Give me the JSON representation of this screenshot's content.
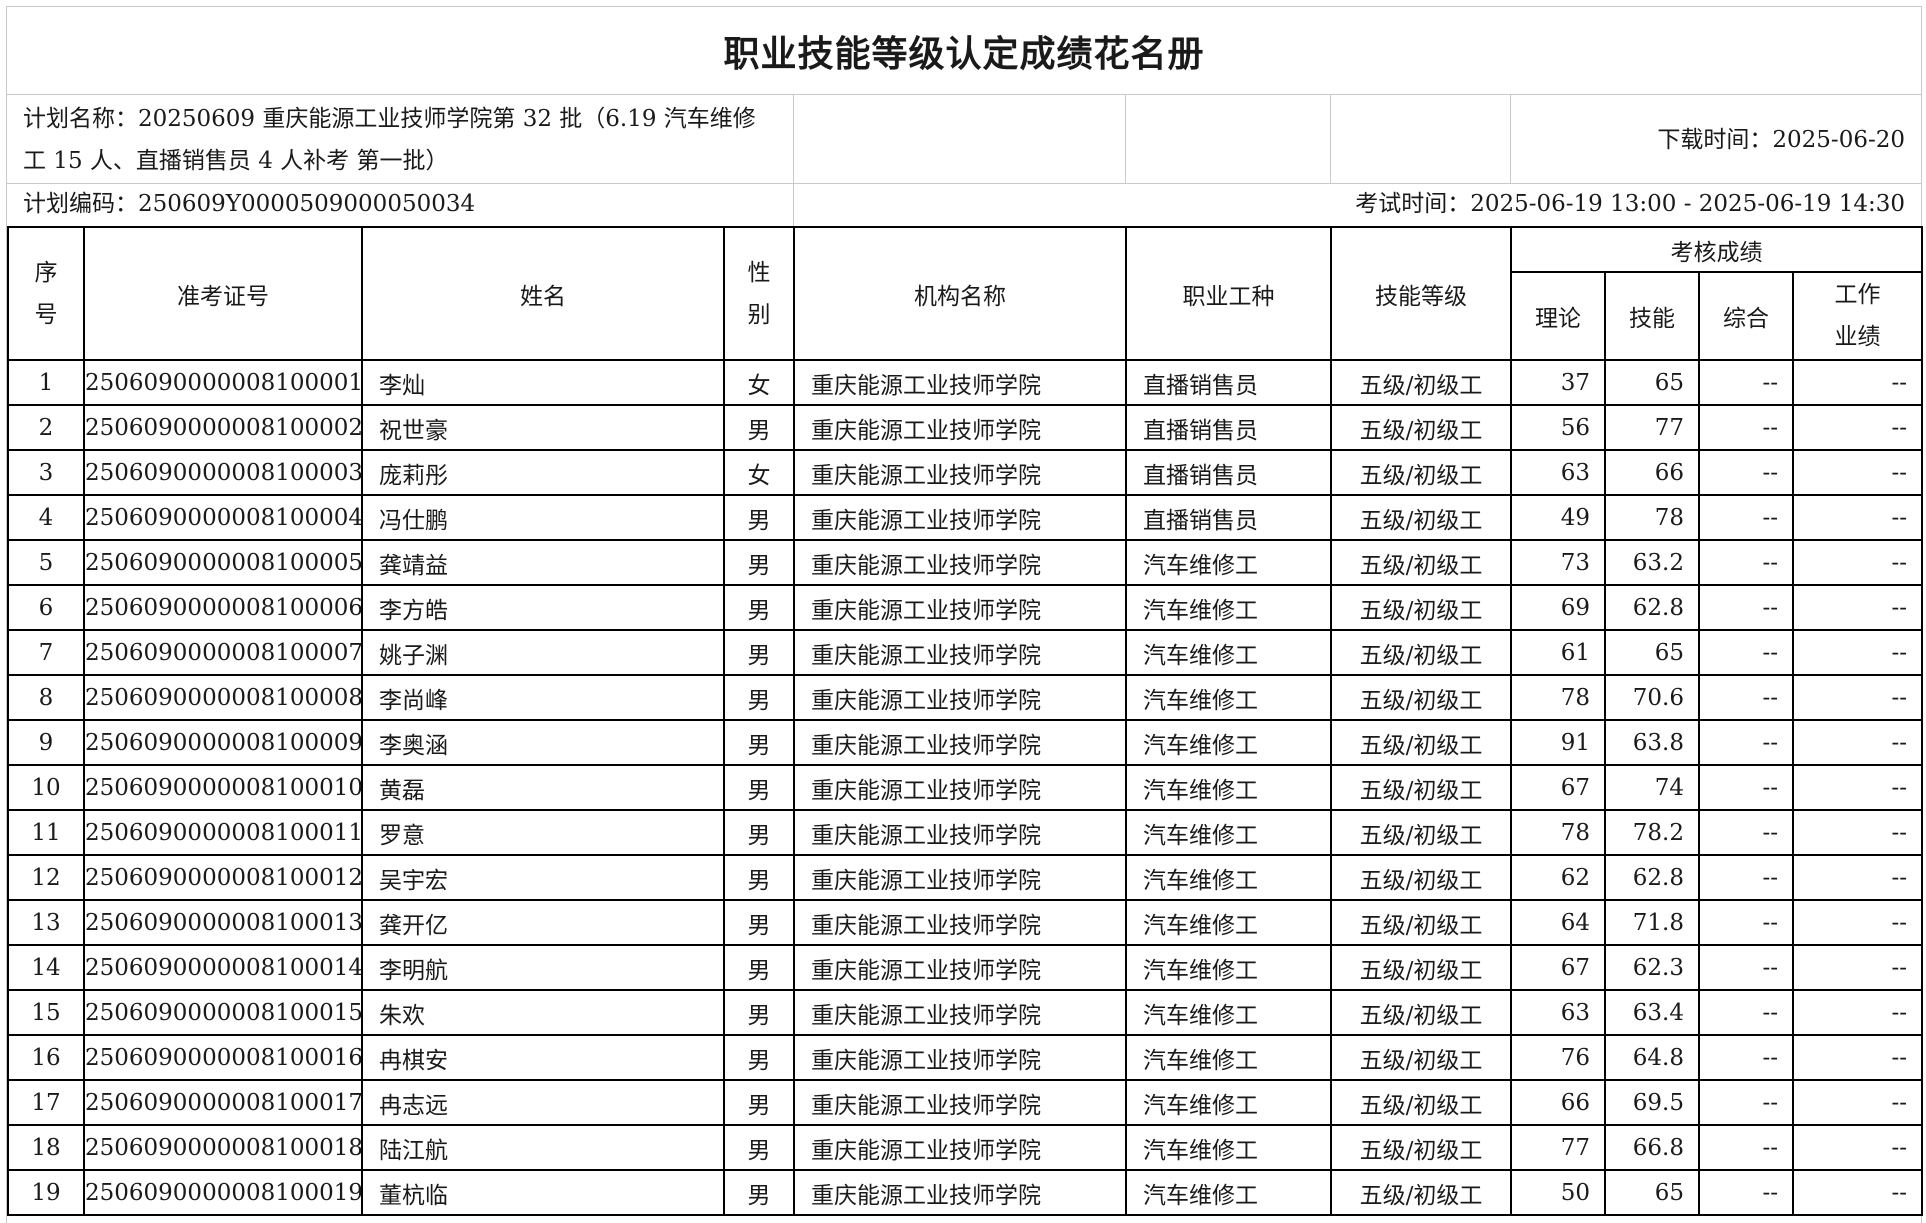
{
  "title": "职业技能等级认定成绩花名册",
  "info": {
    "plan_name_line1": "计划名称：20250609 重庆能源工业技师学院第 32 批（6.19 汽车维修",
    "plan_name_line2": "工 15 人、直播销售员 4 人补考 第一批）",
    "download_time": "下载时间：2025-06-20",
    "plan_code": "计划编码：250609Y000050900005003​4",
    "exam_time": "考试时间：2025-06-19 13:00 - 2025-06-19 14:30"
  },
  "headers": {
    "seq_1": "序",
    "seq_2": "号",
    "ticket": "准考证号",
    "name": "姓名",
    "gender_1": "性",
    "gender_2": "别",
    "org": "机构名称",
    "occupation": "职业工种",
    "level": "技能等级",
    "scores_group": "考核成绩",
    "theory": "理论",
    "skill": "技能",
    "overall": "综合",
    "work_1": "工作",
    "work_2": "业绩"
  },
  "rows": [
    {
      "seq": "1",
      "ticket": "2506090000008100001",
      "name": "李灿",
      "gender": "女",
      "org": "重庆能源工业技师学院",
      "occupation": "直播销售员",
      "level": "五级/初级工",
      "theory": "37",
      "skill": "65",
      "overall": "--",
      "work": "--"
    },
    {
      "seq": "2",
      "ticket": "2506090000008100002",
      "name": "祝世豪",
      "gender": "男",
      "org": "重庆能源工业技师学院",
      "occupation": "直播销售员",
      "level": "五级/初级工",
      "theory": "56",
      "skill": "77",
      "overall": "--",
      "work": "--"
    },
    {
      "seq": "3",
      "ticket": "2506090000008100003",
      "name": "庞莉彤",
      "gender": "女",
      "org": "重庆能源工业技师学院",
      "occupation": "直播销售员",
      "level": "五级/初级工",
      "theory": "63",
      "skill": "66",
      "overall": "--",
      "work": "--"
    },
    {
      "seq": "4",
      "ticket": "2506090000008100004",
      "name": "冯仕鹏",
      "gender": "男",
      "org": "重庆能源工业技师学院",
      "occupation": "直播销售员",
      "level": "五级/初级工",
      "theory": "49",
      "skill": "78",
      "overall": "--",
      "work": "--"
    },
    {
      "seq": "5",
      "ticket": "2506090000008100005",
      "name": "龚靖益",
      "gender": "男",
      "org": "重庆能源工业技师学院",
      "occupation": "汽车维修工",
      "level": "五级/初级工",
      "theory": "73",
      "skill": "63.2",
      "overall": "--",
      "work": "--"
    },
    {
      "seq": "6",
      "ticket": "2506090000008100006",
      "name": "李方皓",
      "gender": "男",
      "org": "重庆能源工业技师学院",
      "occupation": "汽车维修工",
      "level": "五级/初级工",
      "theory": "69",
      "skill": "62.8",
      "overall": "--",
      "work": "--"
    },
    {
      "seq": "7",
      "ticket": "2506090000008100007",
      "name": "姚子渊",
      "gender": "男",
      "org": "重庆能源工业技师学院",
      "occupation": "汽车维修工",
      "level": "五级/初级工",
      "theory": "61",
      "skill": "65",
      "overall": "--",
      "work": "--"
    },
    {
      "seq": "8",
      "ticket": "2506090000008100008",
      "name": "李尚峰",
      "gender": "男",
      "org": "重庆能源工业技师学院",
      "occupation": "汽车维修工",
      "level": "五级/初级工",
      "theory": "78",
      "skill": "70.6",
      "overall": "--",
      "work": "--"
    },
    {
      "seq": "9",
      "ticket": "2506090000008100009",
      "name": "李奥涵",
      "gender": "男",
      "org": "重庆能源工业技师学院",
      "occupation": "汽车维修工",
      "level": "五级/初级工",
      "theory": "91",
      "skill": "63.8",
      "overall": "--",
      "work": "--"
    },
    {
      "seq": "10",
      "ticket": "2506090000008100010",
      "name": "黄磊",
      "gender": "男",
      "org": "重庆能源工业技师学院",
      "occupation": "汽车维修工",
      "level": "五级/初级工",
      "theory": "67",
      "skill": "74",
      "overall": "--",
      "work": "--"
    },
    {
      "seq": "11",
      "ticket": "2506090000008100011",
      "name": "罗意",
      "gender": "男",
      "org": "重庆能源工业技师学院",
      "occupation": "汽车维修工",
      "level": "五级/初级工",
      "theory": "78",
      "skill": "78.2",
      "overall": "--",
      "work": "--"
    },
    {
      "seq": "12",
      "ticket": "2506090000008100012",
      "name": "吴宇宏",
      "gender": "男",
      "org": "重庆能源工业技师学院",
      "occupation": "汽车维修工",
      "level": "五级/初级工",
      "theory": "62",
      "skill": "62.8",
      "overall": "--",
      "work": "--"
    },
    {
      "seq": "13",
      "ticket": "2506090000008100013",
      "name": "龚开亿",
      "gender": "男",
      "org": "重庆能源工业技师学院",
      "occupation": "汽车维修工",
      "level": "五级/初级工",
      "theory": "64",
      "skill": "71.8",
      "overall": "--",
      "work": "--"
    },
    {
      "seq": "14",
      "ticket": "2506090000008100014",
      "name": "李明航",
      "gender": "男",
      "org": "重庆能源工业技师学院",
      "occupation": "汽车维修工",
      "level": "五级/初级工",
      "theory": "67",
      "skill": "62.3",
      "overall": "--",
      "work": "--"
    },
    {
      "seq": "15",
      "ticket": "2506090000008100015",
      "name": "朱欢",
      "gender": "男",
      "org": "重庆能源工业技师学院",
      "occupation": "汽车维修工",
      "level": "五级/初级工",
      "theory": "63",
      "skill": "63.4",
      "overall": "--",
      "work": "--"
    },
    {
      "seq": "16",
      "ticket": "2506090000008100016",
      "name": "冉棋安",
      "gender": "男",
      "org": "重庆能源工业技师学院",
      "occupation": "汽车维修工",
      "level": "五级/初级工",
      "theory": "76",
      "skill": "64.8",
      "overall": "--",
      "work": "--"
    },
    {
      "seq": "17",
      "ticket": "2506090000008100017",
      "name": "冉志远",
      "gender": "男",
      "org": "重庆能源工业技师学院",
      "occupation": "汽车维修工",
      "level": "五级/初级工",
      "theory": "66",
      "skill": "69.5",
      "overall": "--",
      "work": "--"
    },
    {
      "seq": "18",
      "ticket": "2506090000008100018",
      "name": "陆江航",
      "gender": "男",
      "org": "重庆能源工业技师学院",
      "occupation": "汽车维修工",
      "level": "五级/初级工",
      "theory": "77",
      "skill": "66.8",
      "overall": "--",
      "work": "--"
    },
    {
      "seq": "19",
      "ticket": "2506090000008100019",
      "name": "董杭临",
      "gender": "男",
      "org": "重庆能源工业技师学院",
      "occupation": "汽车维修工",
      "level": "五级/初级工",
      "theory": "50",
      "skill": "65",
      "overall": "--",
      "work": "--"
    }
  ]
}
